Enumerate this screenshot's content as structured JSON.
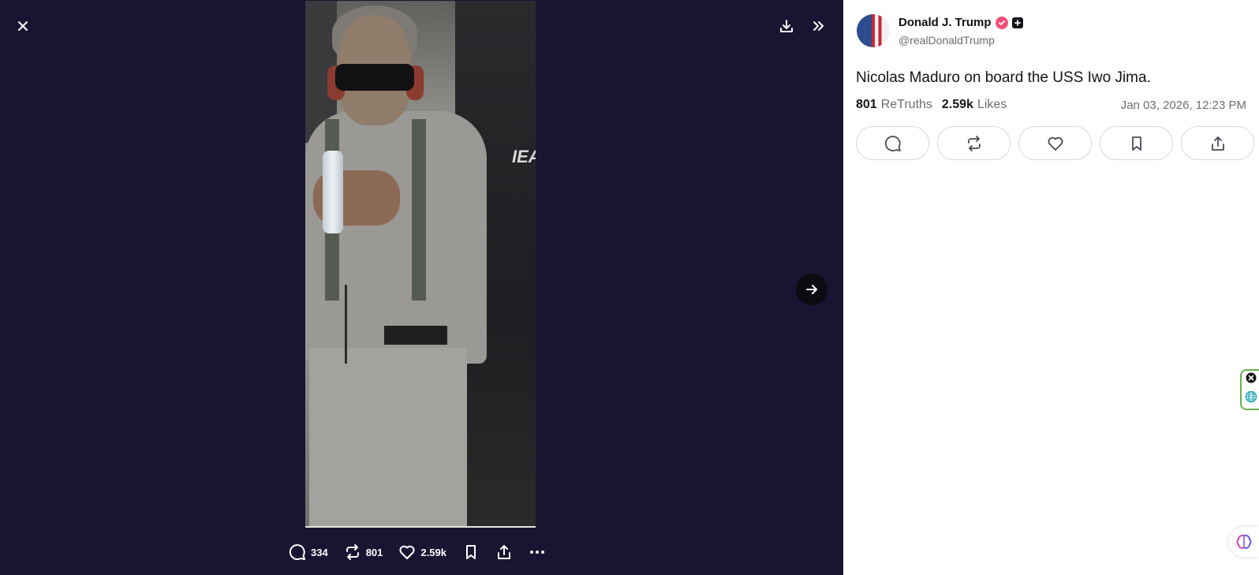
{
  "viewer": {
    "background": "#171531",
    "icons": {
      "close": "close-icon",
      "download": "download-icon",
      "collapse": "chevrons-right-icon",
      "next": "arrow-right-icon"
    },
    "photo_text": "IEA"
  },
  "action_bar": {
    "replies": "334",
    "retruths": "801",
    "likes": "2.59k"
  },
  "post": {
    "author_name": "Donald J. Trump",
    "handle": "@realDonaldTrump",
    "text": "Nicolas Maduro on board the USS Iwo Jima.",
    "retruths_count": "801",
    "retruths_label": "ReTruths",
    "likes_count": "2.59k",
    "likes_label": "Likes",
    "timestamp": "Jan 03, 2026, 12:23 PM"
  },
  "colors": {
    "verified": "#f0507a",
    "panel_bg": "#ffffff",
    "ext_border": "#6ab04c"
  }
}
